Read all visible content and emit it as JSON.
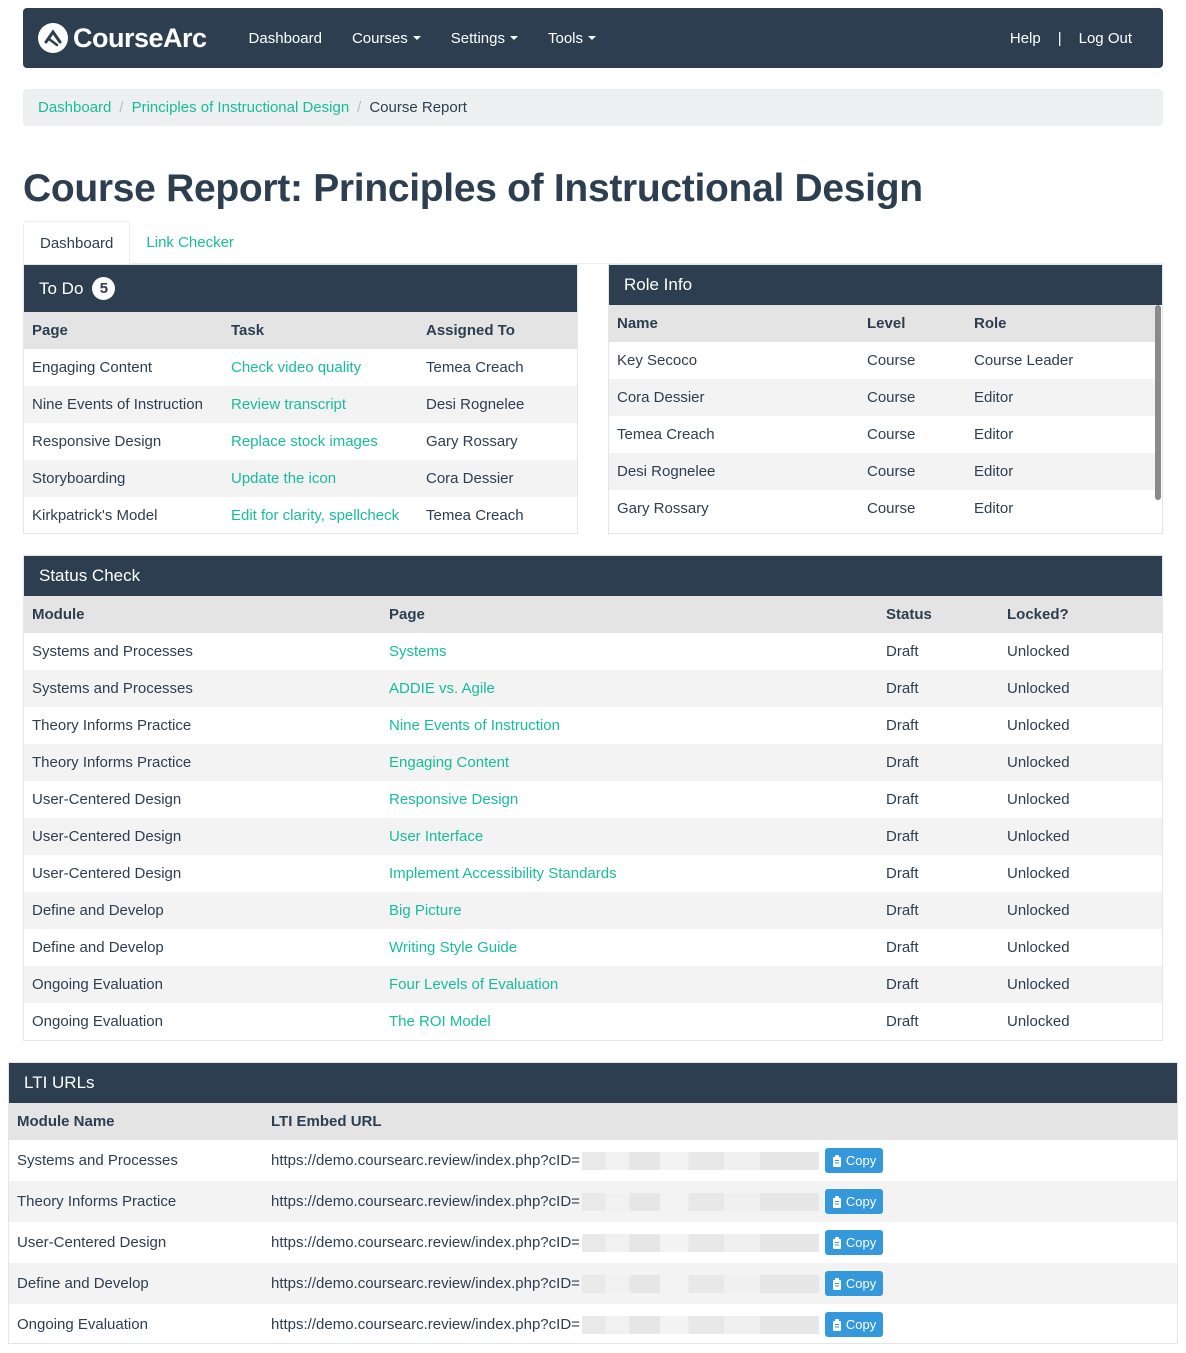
{
  "navbar": {
    "brand": "CourseArc",
    "items": [
      {
        "label": "Dashboard",
        "dropdown": false
      },
      {
        "label": "Courses",
        "dropdown": true
      },
      {
        "label": "Settings",
        "dropdown": true
      },
      {
        "label": "Tools",
        "dropdown": true
      }
    ],
    "help": "Help",
    "separator": "|",
    "logout": "Log Out"
  },
  "breadcrumb": {
    "items": [
      "Dashboard",
      "Principles of Instructional Design"
    ],
    "active": "Course Report",
    "separator": "/"
  },
  "page_title": "Course Report: Principles of Instructional Design",
  "tabs": [
    {
      "label": "Dashboard",
      "active": true
    },
    {
      "label": "Link Checker",
      "active": false
    }
  ],
  "todo": {
    "title": "To Do",
    "count": "5",
    "headers": [
      "Page",
      "Task",
      "Assigned To"
    ],
    "rows": [
      {
        "page": "Engaging Content",
        "task": "Check video quality",
        "assigned": "Temea Creach"
      },
      {
        "page": "Nine Events of Instruction",
        "task": "Review transcript",
        "assigned": "Desi Rognelee"
      },
      {
        "page": "Responsive Design",
        "task": "Replace stock images",
        "assigned": "Gary Rossary"
      },
      {
        "page": "Storyboarding",
        "task": "Update the icon",
        "assigned": "Cora Dessier"
      },
      {
        "page": "Kirkpatrick's Model",
        "task": "Edit for clarity, spellcheck",
        "assigned": "Temea Creach"
      }
    ]
  },
  "role_info": {
    "title": "Role Info",
    "headers": [
      "Name",
      "Level",
      "Role"
    ],
    "rows": [
      {
        "name": "Key Secoco",
        "level": "Course",
        "role": "Course Leader"
      },
      {
        "name": "Cora Dessier",
        "level": "Course",
        "role": "Editor"
      },
      {
        "name": "Temea Creach",
        "level": "Course",
        "role": "Editor"
      },
      {
        "name": "Desi Rognelee",
        "level": "Course",
        "role": "Editor"
      },
      {
        "name": "Gary Rossary",
        "level": "Course",
        "role": "Editor"
      }
    ]
  },
  "status_check": {
    "title": "Status Check",
    "headers": [
      "Module",
      "Page",
      "Status",
      "Locked?"
    ],
    "rows": [
      {
        "module": "Systems and Processes",
        "page": "Systems",
        "status": "Draft",
        "locked": "Unlocked"
      },
      {
        "module": "Systems and Processes",
        "page": "ADDIE vs. Agile",
        "status": "Draft",
        "locked": "Unlocked"
      },
      {
        "module": "Theory Informs Practice",
        "page": "Nine Events of Instruction",
        "status": "Draft",
        "locked": "Unlocked"
      },
      {
        "module": "Theory Informs Practice",
        "page": "Engaging Content",
        "status": "Draft",
        "locked": "Unlocked"
      },
      {
        "module": "User-Centered Design",
        "page": "Responsive Design",
        "status": "Draft",
        "locked": "Unlocked"
      },
      {
        "module": "User-Centered Design",
        "page": "User Interface",
        "status": "Draft",
        "locked": "Unlocked"
      },
      {
        "module": "User-Centered Design",
        "page": "Implement Accessibility Standards",
        "status": "Draft",
        "locked": "Unlocked"
      },
      {
        "module": "Define and Develop",
        "page": "Big Picture",
        "status": "Draft",
        "locked": "Unlocked"
      },
      {
        "module": "Define and Develop",
        "page": "Writing Style Guide",
        "status": "Draft",
        "locked": "Unlocked"
      },
      {
        "module": "Ongoing Evaluation",
        "page": "Four Levels of Evaluation",
        "status": "Draft",
        "locked": "Unlocked"
      },
      {
        "module": "Ongoing Evaluation",
        "page": "The ROI Model",
        "status": "Draft",
        "locked": "Unlocked"
      }
    ]
  },
  "lti_urls": {
    "title": "LTI URLs",
    "headers": [
      "Module Name",
      "LTI Embed URL"
    ],
    "copy_label": "Copy",
    "rows": [
      {
        "module": "Systems and Processes",
        "url": "https://demo.coursearc.review/index.php?cID="
      },
      {
        "module": "Theory Informs Practice",
        "url": "https://demo.coursearc.review/index.php?cID="
      },
      {
        "module": "User-Centered Design",
        "url": "https://demo.coursearc.review/index.php?cID="
      },
      {
        "module": "Define and Develop",
        "url": "https://demo.coursearc.review/index.php?cID="
      },
      {
        "module": "Ongoing Evaluation",
        "url": "https://demo.coursearc.review/index.php?cID="
      }
    ]
  },
  "colors": {
    "primary": "#2c3e50",
    "link": "#18bc9c",
    "copy_button": "#3498db",
    "header_row": "#e4e4e4",
    "breadcrumb_bg": "#ecf0f1"
  }
}
